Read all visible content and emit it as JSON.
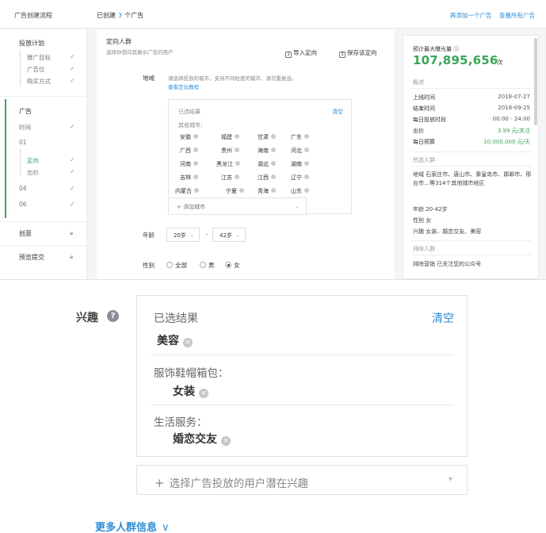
{
  "header": {
    "title": "广告创建流程",
    "crumb_prefix": "已创建",
    "crumb_count": "3",
    "crumb_suffix": "个广告",
    "link_add": "再添加一个广告",
    "link_all": "查看所有广告"
  },
  "sidebar": {
    "group1_title": "投放计划",
    "group1_items": [
      "推广目标",
      "广告位",
      "购买方式"
    ],
    "group2_title": "广告",
    "group2_items": [
      "时间",
      "01",
      "定向",
      "出价",
      "04",
      "06"
    ],
    "creative": "创意",
    "preview": "预览提交"
  },
  "targeting": {
    "title": "定向人群",
    "subtitle": "选择你想向其展示广告的用户",
    "import_label": "导入定向",
    "save_label": "保存该定向",
    "region_label": "地域",
    "region_hint": "请选择投放的城市，支持不同粒度的城市、请勿重复选。",
    "region_link": "查看定位教程",
    "box_title": "已选结果",
    "box_clear": "清空",
    "box_other": "其他城市：",
    "cities": [
      [
        "安徽",
        "福建",
        "甘肃",
        "广东"
      ],
      [
        "广西",
        "贵州",
        "海南",
        "河北"
      ],
      [
        "河南",
        "黑龙江",
        "湖北",
        "湖南"
      ],
      [
        "吉林",
        "江苏",
        "江西",
        "辽宁"
      ],
      [
        "内蒙古",
        "宁夏",
        "青海",
        "山东"
      ]
    ],
    "add_city": "+ 添加城市",
    "age_label": "年龄",
    "age_from": "20岁",
    "age_to": "42岁",
    "age_dash": "-",
    "gender_label": "性别",
    "gender_options": [
      "全部",
      "男",
      "女"
    ],
    "gender_selected": "女"
  },
  "summary": {
    "reach_label": "预计最大曝光量",
    "reach_value": "107,895,656",
    "reach_unit": "次",
    "overview_head": "概述",
    "rows": [
      {
        "k": "上线时间",
        "v": "2018-07-27"
      },
      {
        "k": "结束时间",
        "v": "2018-09-25"
      },
      {
        "k": "每日投放时段",
        "v": "00:00 - 24:00"
      },
      {
        "k": "出价",
        "v": "3.99 元/关注"
      },
      {
        "k": "每日预算",
        "v": "10,000,000 元/天"
      }
    ],
    "audience_head": "所选人群",
    "region_text": "地域  石家庄市、唐山市、秦皇岛市、邯郸市、邢台市…等314个其他城市地区",
    "age_text": "年龄  20-42岁",
    "gender_text": "性别  女",
    "interest_text": "兴趣  女装、婚恋交友、美容",
    "exclude_head": "排除人群",
    "exclude_text": "排除营销  已关注您的公众号"
  },
  "interest": {
    "label": "兴趣",
    "help": "?",
    "box_title": "已选结果",
    "clear": "清空",
    "top_chip": "美容",
    "groups": [
      {
        "category": "服饰鞋帽箱包：",
        "chip": "女装"
      },
      {
        "category": "生活服务：",
        "chip": "婚恋交友"
      }
    ],
    "add_prefix": "+",
    "add_text": "选择广告投放的用户潜在兴趣",
    "chevron": "▾",
    "more": "更多人群信息",
    "more_chevron": "∨"
  },
  "colors": {
    "accent_blue": "#2b8bd4",
    "accent_green": "#3aa655"
  }
}
